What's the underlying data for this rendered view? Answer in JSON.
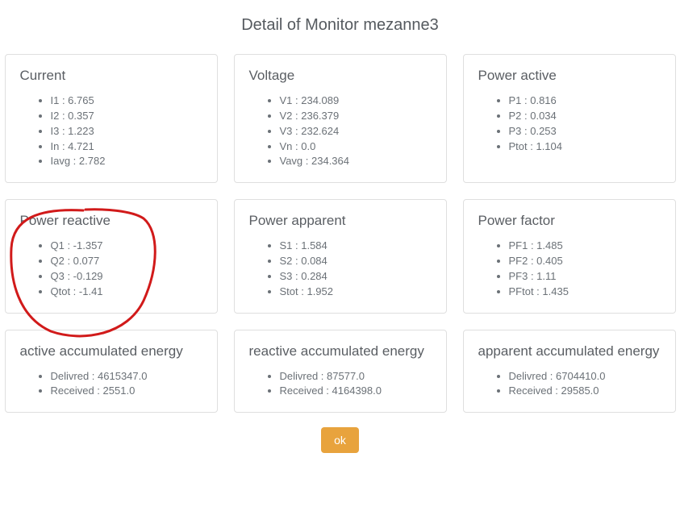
{
  "title": "Detail of Monitor mezanne3",
  "cards": {
    "current": {
      "title": "Current",
      "items": [
        "I1 : 6.765",
        "I2 : 0.357",
        "I3 : 1.223",
        "In : 4.721",
        "Iavg : 2.782"
      ]
    },
    "voltage": {
      "title": "Voltage",
      "items": [
        "V1 : 234.089",
        "V2 : 236.379",
        "V3 : 232.624",
        "Vn : 0.0",
        "Vavg : 234.364"
      ]
    },
    "power_active": {
      "title": "Power active",
      "items": [
        "P1 : 0.816",
        "P2 : 0.034",
        "P3 : 0.253",
        "Ptot : 1.104"
      ]
    },
    "power_reactive": {
      "title": "Power reactive",
      "items": [
        "Q1 : -1.357",
        "Q2 : 0.077",
        "Q3 : -0.129",
        "Qtot : -1.41"
      ]
    },
    "power_apparent": {
      "title": "Power apparent",
      "items": [
        "S1 : 1.584",
        "S2 : 0.084",
        "S3 : 0.284",
        "Stot : 1.952"
      ]
    },
    "power_factor": {
      "title": "Power factor",
      "items": [
        "PF1 : 1.485",
        "PF2 : 0.405",
        "PF3 : 1.11",
        "PFtot : 1.435"
      ]
    },
    "active_accum": {
      "title": "active accumulated energy",
      "items": [
        "Delivred : 4615347.0",
        "Received : 2551.0"
      ]
    },
    "reactive_accum": {
      "title": "reactive accumulated energy",
      "items": [
        "Delivred : 87577.0",
        "Received : 4164398.0"
      ]
    },
    "apparent_accum": {
      "title": "apparent accumulated energy",
      "items": [
        "Delivred : 6704410.0",
        "Received : 29585.0"
      ]
    }
  },
  "ok_label": "ok"
}
